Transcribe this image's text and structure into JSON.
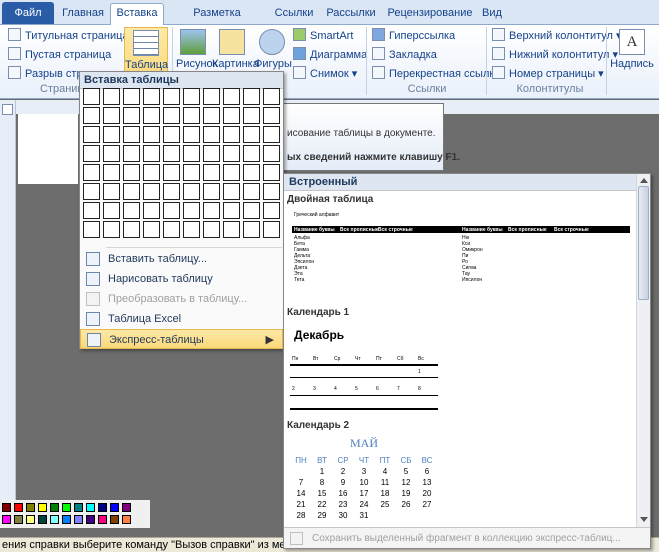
{
  "ribbon_tabs": [
    "Файл",
    "Главная",
    "Вставка",
    "Разметка страницы",
    "Ссылки",
    "Рассылки",
    "Рецензирование",
    "Вид"
  ],
  "ribbon": {
    "pages_group": {
      "items": [
        "Титульная страница",
        "Пустая страница",
        "Разрыв страницы"
      ],
      "label": "Страниц"
    },
    "table_button": "Таблица",
    "illustrations": {
      "picture": "Рисунок",
      "clipart": "Картинка",
      "shapes": "Фигуры",
      "smartart": "SmartArt",
      "chart": "Диаграмма",
      "screenshot": "Снимок"
    },
    "links_group": {
      "items": [
        "Гиперссылка",
        "Закладка",
        "Перекрестная ссылка"
      ],
      "label": "Ссылки"
    },
    "header_footer_group": {
      "items": [
        "Верхний колонтитул",
        "Нижний колонтитул",
        "Номер страницы"
      ],
      "label": "Колонтитулы"
    },
    "textbox": "Надпись"
  },
  "tooltip": {
    "line1": "исование таблицы в документе.",
    "line2": "ых сведений нажмите клавишу F1."
  },
  "table_menu": {
    "header": "Вставка таблицы",
    "grid": {
      "cols": 10,
      "rows": 8
    },
    "items": [
      {
        "label": "Вставить таблицу...",
        "icon": "insert-table-icon",
        "disabled": false
      },
      {
        "label": "Нарисовать таблицу",
        "icon": "draw-table-icon",
        "disabled": false
      },
      {
        "label": "Преобразовать в таблицу...",
        "icon": "convert-table-icon",
        "disabled": true
      },
      {
        "label": "Таблица Excel",
        "icon": "excel-icon",
        "disabled": false
      },
      {
        "label": "Экспресс-таблицы",
        "icon": "quick-tables-icon",
        "disabled": false,
        "highlighted": true,
        "submenu": true
      }
    ]
  },
  "gallery": {
    "header": "Встроенный",
    "double_table": {
      "title": "Двойная таблица",
      "caption": "Греческий алфавит",
      "columns": [
        "Название буквы",
        "Все прописные",
        "Все строчные",
        "Название буквы",
        "Все прописные",
        "Все строчные"
      ],
      "left_names": [
        "Альфа",
        "Бета",
        "Гамма",
        "Дельта",
        "Эпсилон",
        "Дзета",
        "Эта",
        "Тета"
      ],
      "right_names": [
        "Ню",
        "Кси",
        "Омикрон",
        "Пи",
        "Ро",
        "Сигма",
        "Тау",
        "Ипсилон"
      ]
    },
    "calendar1": {
      "title": "Календарь 1",
      "month": "Декабрь",
      "days": [
        "Пн",
        "Вт",
        "Ср",
        "Чт",
        "Пт",
        "Сб",
        "Вс"
      ],
      "week1": [
        "1"
      ],
      "week2": [
        "2",
        "3",
        "4",
        "5",
        "6",
        "7",
        "8"
      ]
    },
    "calendar2": {
      "title": "Календарь 2",
      "month": "МАЙ",
      "days": [
        "ПН",
        "ВТ",
        "СР",
        "ЧТ",
        "ПТ",
        "СБ",
        "ВС"
      ],
      "weeks": [
        [
          "",
          "1",
          "2",
          "3",
          "4",
          "5",
          "6"
        ],
        [
          "7",
          "8",
          "9",
          "10",
          "11",
          "12",
          "13"
        ],
        [
          "14",
          "15",
          "16",
          "17",
          "18",
          "19",
          "20"
        ],
        [
          "21",
          "22",
          "23",
          "24",
          "25",
          "26",
          "27"
        ],
        [
          "28",
          "29",
          "30",
          "31",
          "",
          "",
          ""
        ]
      ]
    },
    "footer": "Сохранить выделенный фрагмент в коллекцию экспресс-таблиц..."
  },
  "statusbar": "ения справки выберите команду \"Вызов справки\" из меню \"Сп",
  "palette_colors": [
    "#800000",
    "#ff0000",
    "#808000",
    "#ffff00",
    "#008000",
    "#00ff00",
    "#008080",
    "#00ffff",
    "#000080",
    "#0000ff",
    "#800080",
    "#ff00ff",
    "#808040",
    "#ffff80",
    "#004040",
    "#80ffff",
    "#0080ff",
    "#8080ff",
    "#400080",
    "#ff0080",
    "#804000",
    "#ff8040"
  ]
}
